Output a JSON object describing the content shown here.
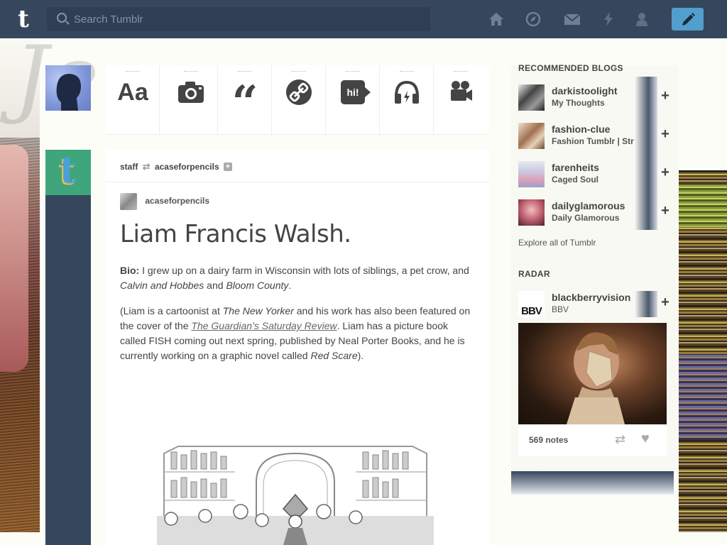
{
  "header": {
    "logo": "t",
    "search_placeholder": "Search Tumblr",
    "nav_icons": [
      "home-icon",
      "explore-compass-icon",
      "inbox-mail-icon",
      "activity-lightning-icon",
      "account-person-icon"
    ],
    "compose_icon": "pencil-icon"
  },
  "post_menu": {
    "types": [
      {
        "id": "text",
        "glyph": "Aa"
      },
      {
        "id": "photo",
        "glyph": ""
      },
      {
        "id": "quote",
        "glyph": "“"
      },
      {
        "id": "link",
        "glyph": ""
      },
      {
        "id": "chat",
        "glyph": "hi!"
      },
      {
        "id": "audio",
        "glyph": ""
      },
      {
        "id": "video",
        "glyph": ""
      }
    ]
  },
  "post": {
    "reblogged_by": "staff",
    "reblogged_from": "acaseforpencils",
    "source_blog": "acaseforpencils",
    "title": "Liam Francis Walsh.",
    "bio_label": "Bio:",
    "bio_text_1": " I grew up on a dairy farm in Wisconsin with lots of siblings, a pet crow, and ",
    "bio_em_1": "Calvin and Hobbes",
    "bio_text_2": " and ",
    "bio_em_2": "Bloom County",
    "bio_text_3": ".",
    "para2_1": "(Liam is a cartoonist at ",
    "para2_em_1": "The New Yorker",
    "para2_2": " and his work has also been featured on the cover of the ",
    "para2_link": "The Guardian’s Saturday Review",
    "para2_3": ". Liam has a picture book called FISH coming out next spring, published by Neal Porter Books, and he is currently working on a graphic novel called ",
    "para2_em_2": "Red Scare",
    "para2_4": ")."
  },
  "sidebar": {
    "recommended_title": "RECOMMENDED BLOGS",
    "blogs": [
      {
        "name": "darkistoolight",
        "title": "My Thoughts"
      },
      {
        "name": "fashion-clue",
        "title": "Fashion Tumblr | Str"
      },
      {
        "name": "farenheits",
        "title": "Caged Soul"
      },
      {
        "name": "dailyglamorous",
        "title": "Daily Glamorous"
      }
    ],
    "explore_label": "Explore all of Tumblr",
    "radar_title": "RADAR",
    "radar": {
      "name": "blackberryvision",
      "title": "BBV",
      "avatar_text": "BBV",
      "notes": "569 notes"
    }
  }
}
